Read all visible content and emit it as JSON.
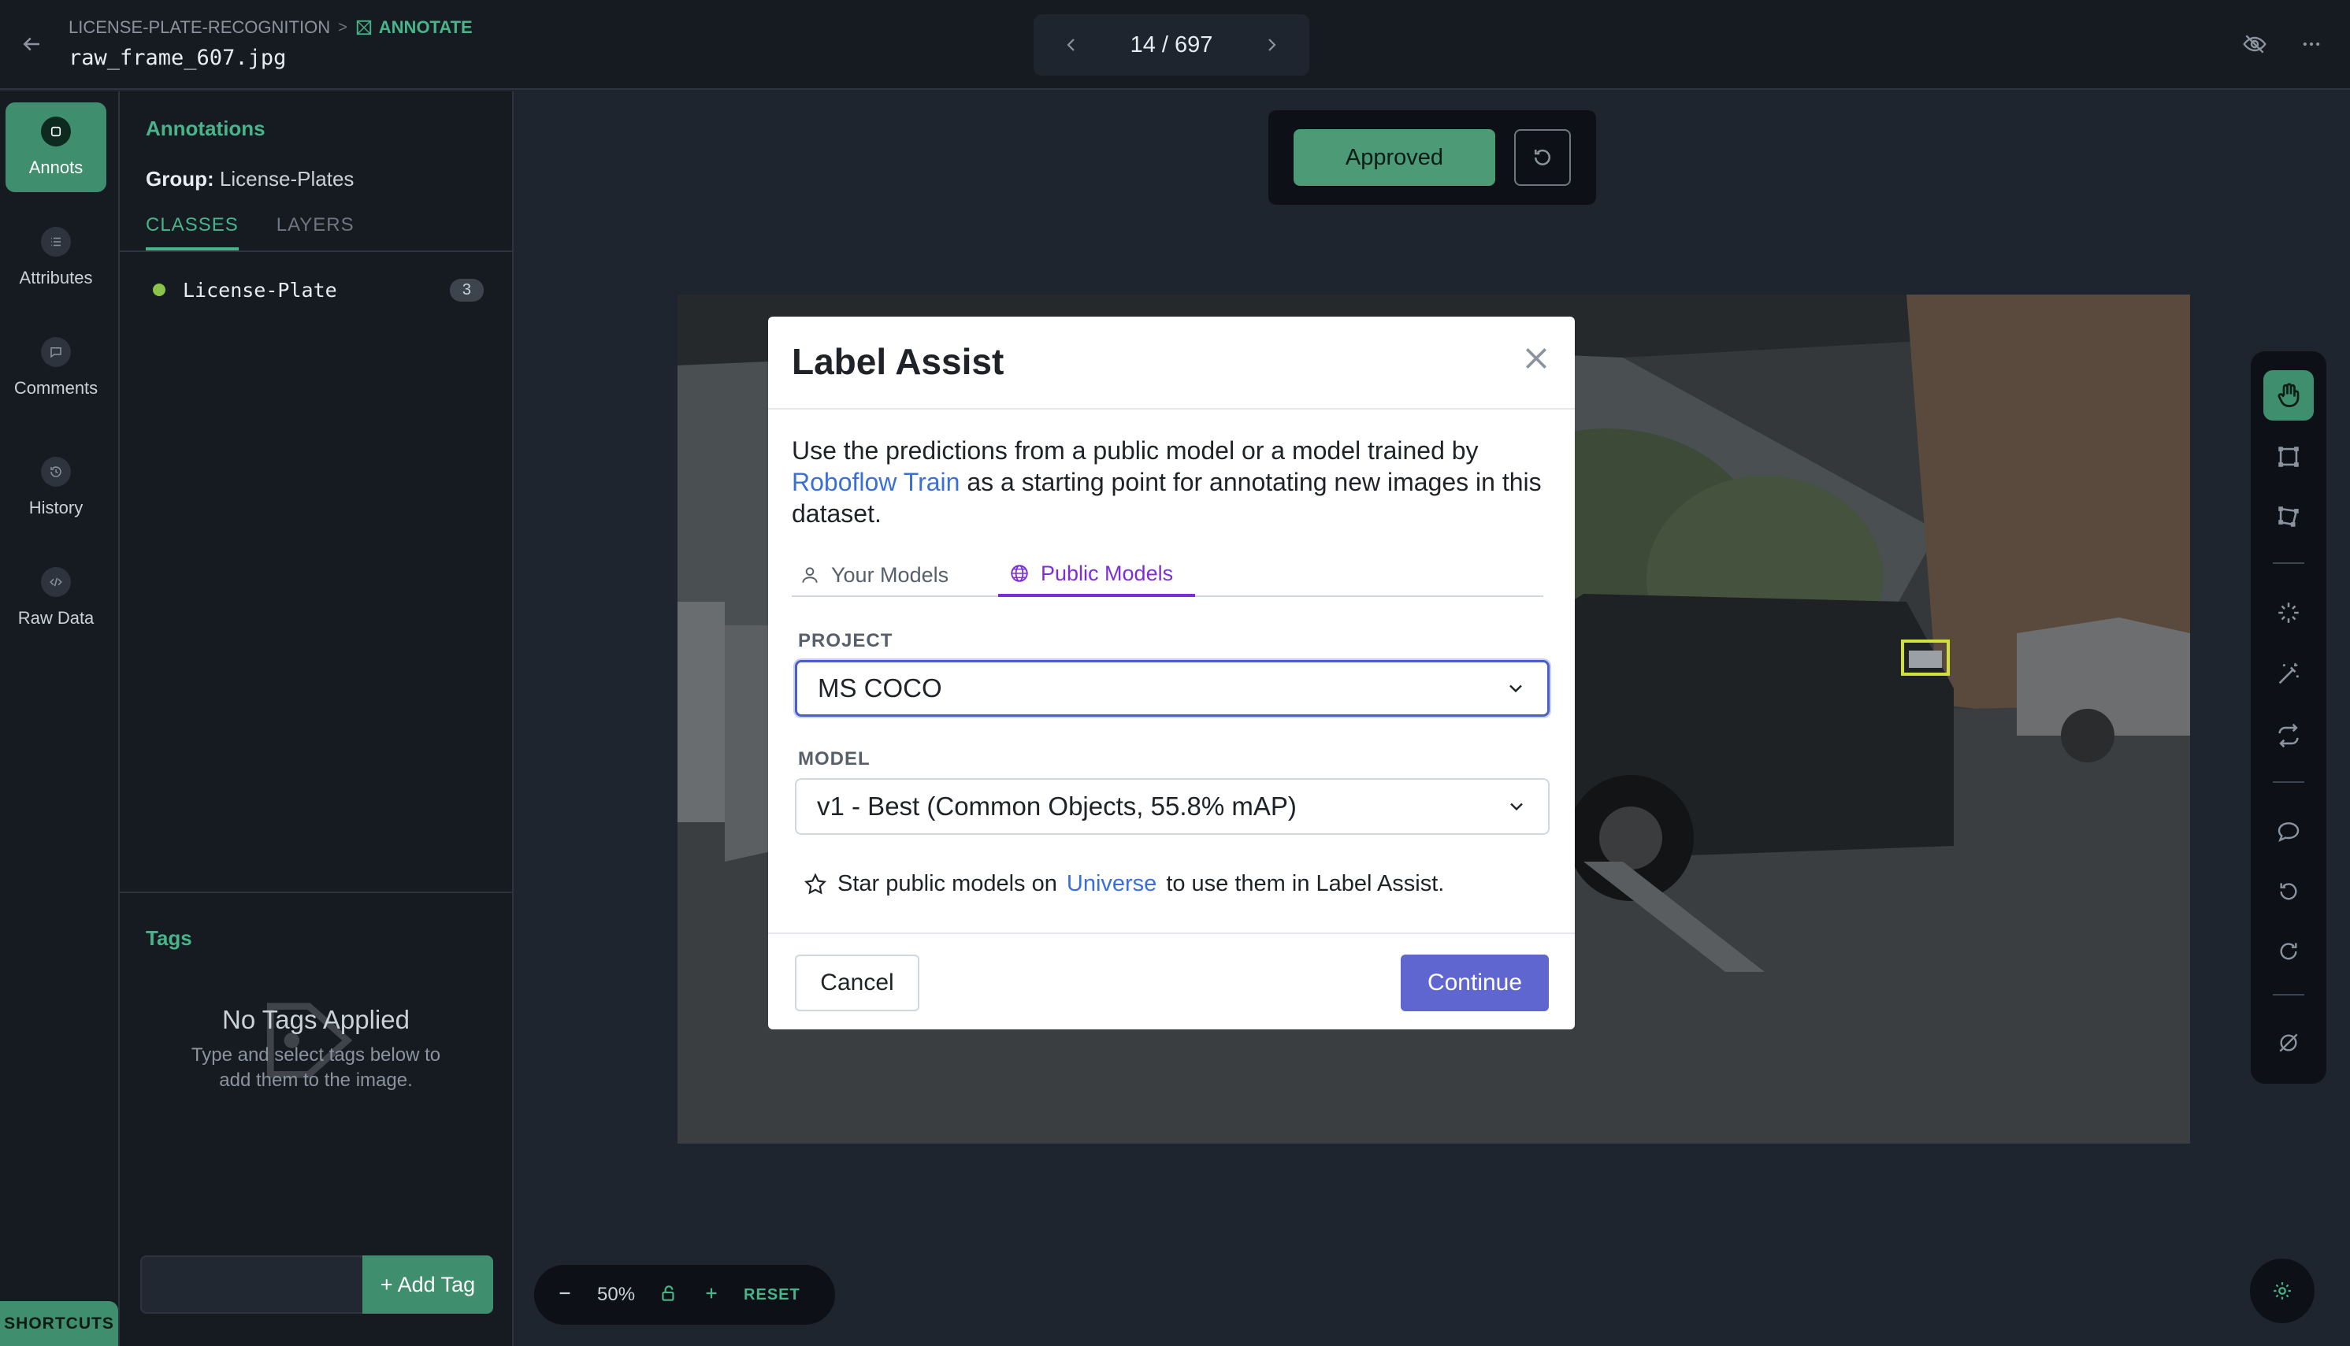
{
  "header": {
    "breadcrumb_project": "LICENSE-PLATE-RECOGNITION",
    "breadcrumb_separator": ">",
    "breadcrumb_page": "ANNOTATE",
    "filename": "raw_frame_607.jpg",
    "pager": "14 / 697"
  },
  "rail": {
    "items": [
      {
        "label": "Annots",
        "icon": "annotation-icon"
      },
      {
        "label": "Attributes",
        "icon": "list-icon"
      },
      {
        "label": "Comments",
        "icon": "comment-icon"
      },
      {
        "label": "History",
        "icon": "history-icon"
      },
      {
        "label": "Raw Data",
        "icon": "code-icon"
      }
    ],
    "shortcuts": "SHORTCUTS"
  },
  "panel": {
    "title": "Annotations",
    "group_label": "Group:",
    "group_value": "License-Plates",
    "tabs": [
      "CLASSES",
      "LAYERS"
    ],
    "classes": [
      {
        "name": "License-Plate",
        "count": "3",
        "color": "#8bc34a"
      }
    ],
    "tags_title": "Tags",
    "tags_empty_title": "No Tags Applied",
    "tags_empty_line1": "Type and select tags below to",
    "tags_empty_line2": "add them to the image.",
    "add_tag": "+ Add Tag"
  },
  "canvas": {
    "approved": "Approved",
    "zoom": "50%",
    "reset": "RESET"
  },
  "modal": {
    "title": "Label Assist",
    "desc_1": "Use the predictions from a public model or a model trained by",
    "desc_link": "Roboflow Train",
    "desc_2": " as a starting point for annotating new images in this dataset.",
    "tabs": [
      "Your Models",
      "Public Models"
    ],
    "active_tab": "Public Models",
    "project_label": "PROJECT",
    "project_value": "MS COCO",
    "model_label": "MODEL",
    "model_value": "v1 - Best (Common Objects, 55.8% mAP)",
    "star_1": "Star public models on",
    "star_link": "Universe",
    "star_2": "to use them in Label Assist.",
    "cancel": "Cancel",
    "continue": "Continue"
  },
  "colors": {
    "accent_green": "#47b48a",
    "button_green": "#3f8f6e",
    "modal_primary": "#5f66d0",
    "tab_purple": "#7c2fd6",
    "link_blue": "#3b6fd8"
  }
}
